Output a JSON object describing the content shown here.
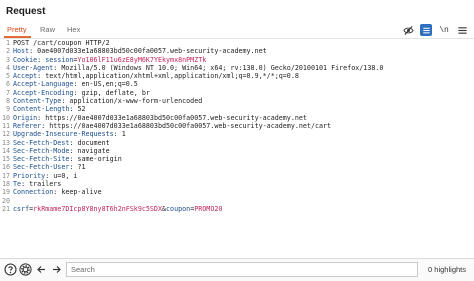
{
  "panel": {
    "title": "Request"
  },
  "tabs": [
    {
      "label": "Pretty"
    },
    {
      "label": "Raw"
    },
    {
      "label": "Hex"
    }
  ],
  "toolbar": {
    "hide_icon": "eye-slash-icon",
    "list_icon": "list-icon",
    "newline_label": "\\n",
    "menu_icon": "hamburger-icon",
    "accent": "#2f6fbf"
  },
  "request_lines": [
    {
      "num": "1",
      "text": "POST /cart/coupon HTTP/2"
    },
    {
      "num": "2",
      "key": "Host",
      "value": "0ae4007d033e1a68803bd50c00fa0057.web-security-academy.net"
    },
    {
      "num": "3",
      "key": "Cookie",
      "cookie_name": "session",
      "cookie_value": "Yo106lF11u6zE8yM6K7YEkymx8nPMZTk"
    },
    {
      "num": "4",
      "key": "User-Agent",
      "value": "Mozilla/5.0 (Windows NT 10.0; Win64; x64; rv:138.0) Gecko/20100101 Firefox/138.0"
    },
    {
      "num": "5",
      "key": "Accept",
      "value": "text/html,application/xhtml+xml,application/xml;q=0.9,*/*;q=0.8"
    },
    {
      "num": "6",
      "key": "Accept-Language",
      "value": "en-US,en;q=0.5"
    },
    {
      "num": "7",
      "key": "Accept-Encoding",
      "value": "gzip, deflate, br"
    },
    {
      "num": "8",
      "key": "Content-Type",
      "value": "application/x-www-form-urlencoded"
    },
    {
      "num": "9",
      "key": "Content-Length",
      "value": "52"
    },
    {
      "num": "10",
      "key": "Origin",
      "value": "https://0ae4007d033e1a68803bd50c00fa0057.web-security-academy.net"
    },
    {
      "num": "11",
      "key": "Referer",
      "value": "https://0ae4007d033e1a68803bd50c00fa0057.web-security-academy.net/cart"
    },
    {
      "num": "12",
      "key": "Upgrade-Insecure-Requests",
      "value": "1"
    },
    {
      "num": "13",
      "key": "Sec-Fetch-Dest",
      "value": "document"
    },
    {
      "num": "14",
      "key": "Sec-Fetch-Mode",
      "value": "navigate"
    },
    {
      "num": "15",
      "key": "Sec-Fetch-Site",
      "value": "same-origin"
    },
    {
      "num": "16",
      "key": "Sec-Fetch-User",
      "value": "?1"
    },
    {
      "num": "17",
      "key": "Priority",
      "value": "u=0, i"
    },
    {
      "num": "18",
      "key": "Te",
      "value": "trailers"
    },
    {
      "num": "19",
      "key": "Connection",
      "value": "keep-alive"
    },
    {
      "num": "20",
      "text": ""
    },
    {
      "num": "21",
      "body_key1": "csrf",
      "body_val1": "rkRmame7DIcp8Y8ny8T6h2nFSk9c5SDX",
      "body_amp": "&",
      "body_key2": "coupon",
      "body_val2": "PROMO20"
    }
  ],
  "statusbar": {
    "help_icon": "help-icon",
    "settings_icon": "settings-gear-icon",
    "back_icon": "arrow-left-icon",
    "forward_icon": "arrow-right-icon",
    "search_placeholder": "Search",
    "search_value": "",
    "highlights_text": "0 highlights"
  }
}
